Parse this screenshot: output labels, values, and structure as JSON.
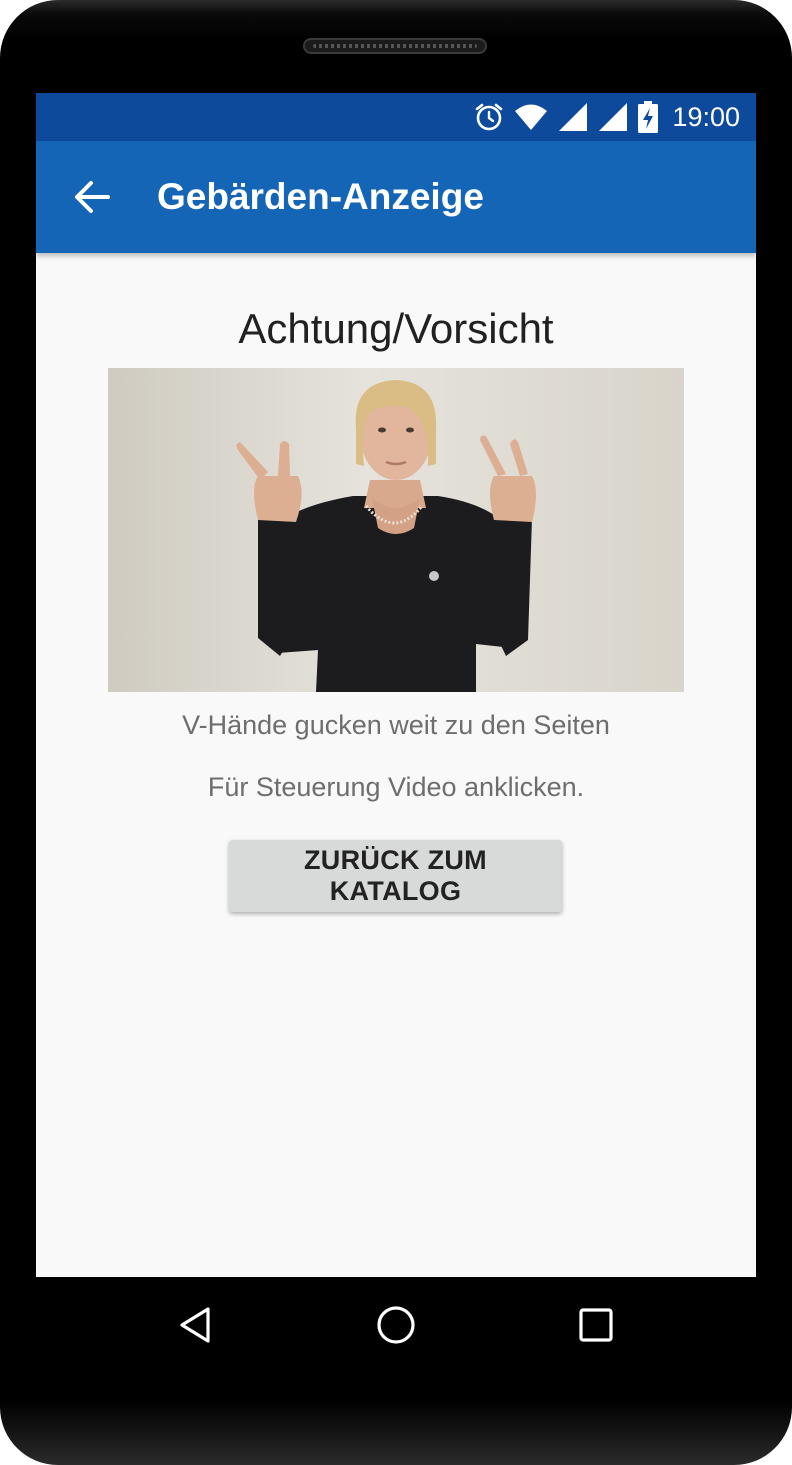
{
  "status_bar": {
    "time": "19:00"
  },
  "app_bar": {
    "title": "Gebärden-Anzeige"
  },
  "main": {
    "sign_title": "Achtung/Vorsicht",
    "description": "V-Hände gucken weit zu den Seiten",
    "hint": "Für Steuerung Video anklicken.",
    "back_to_catalog_label": "ZURÜCK ZUM KATALOG"
  },
  "icons": {
    "status": [
      "alarm-icon",
      "wifi-icon",
      "signal-icon",
      "signal-icon",
      "battery-charging-icon"
    ],
    "app_bar": "arrow-back-icon",
    "nav": [
      "nav-back-icon",
      "nav-home-icon",
      "nav-recents-icon"
    ]
  },
  "colors": {
    "status_bar": "#0d4a9c",
    "app_bar": "#1565b7",
    "background": "#f9f9f9",
    "button": "#d8d9d9"
  }
}
